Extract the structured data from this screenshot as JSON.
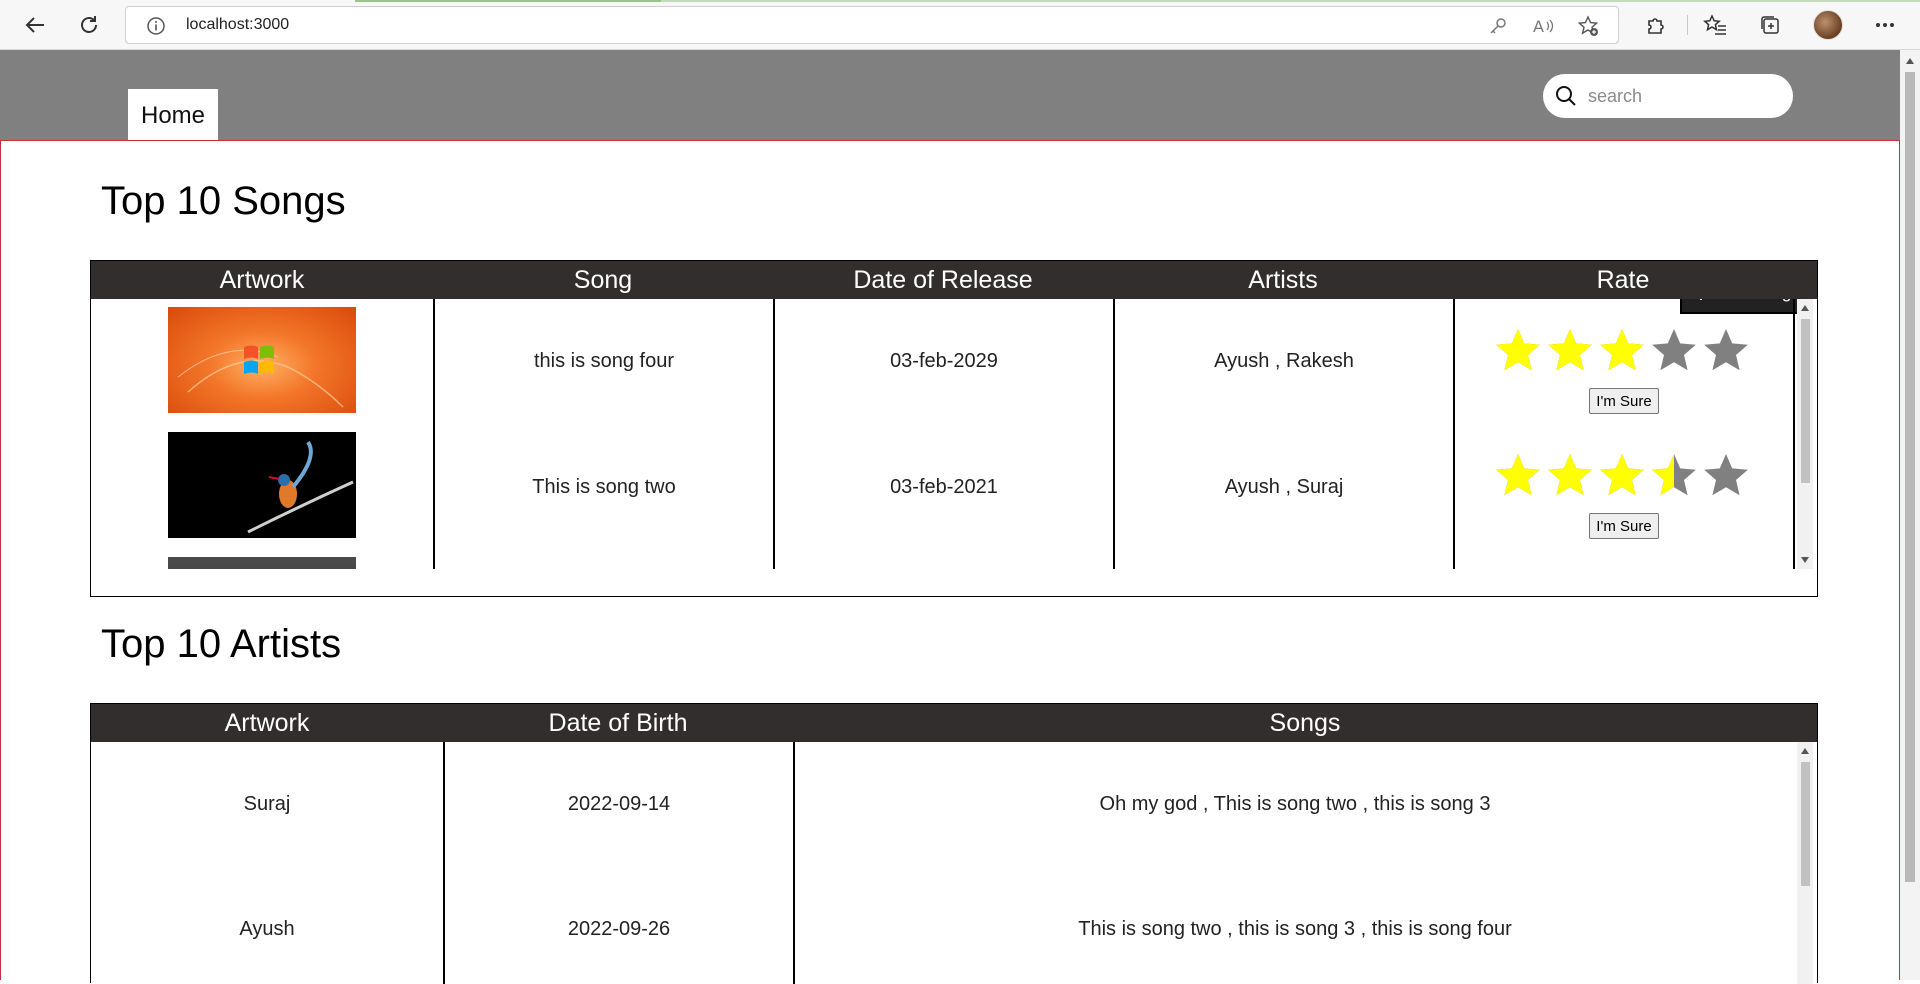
{
  "browser": {
    "url": "localhost:3000"
  },
  "nav": {
    "home_label": "Home",
    "search_placeholder": "search"
  },
  "songs_section": {
    "title": "Top 10 Songs",
    "add_button_label": "Add Song",
    "headers": [
      "Artwork",
      "Song",
      "Date of Release",
      "Artists",
      "Rate"
    ],
    "rows": [
      {
        "song": "this is song four",
        "date": "03-feb-2029",
        "artists": "Ayush , Rakesh",
        "rating": 3,
        "button": "I'm Sure"
      },
      {
        "song": "This is song two",
        "date": "03-feb-2021",
        "artists": "Ayush , Suraj",
        "rating": 3.5,
        "button": "I'm Sure"
      }
    ]
  },
  "artists_section": {
    "title": "Top 10 Artists",
    "headers": [
      "Artwork",
      "Date of Birth",
      "Songs"
    ],
    "rows": [
      {
        "name": "Suraj",
        "dob": "2022-09-14",
        "songs": "Oh my god , This is song two , this is song 3"
      },
      {
        "name": "Ayush",
        "dob": "2022-09-26",
        "songs": "This is song two , this is song 3 , this is song four"
      }
    ]
  },
  "colors": {
    "topbar": "#808080",
    "table_header": "#322e2e",
    "star_filled": "#ffff00",
    "star_empty": "#808080",
    "page_border": "#c8303d"
  }
}
